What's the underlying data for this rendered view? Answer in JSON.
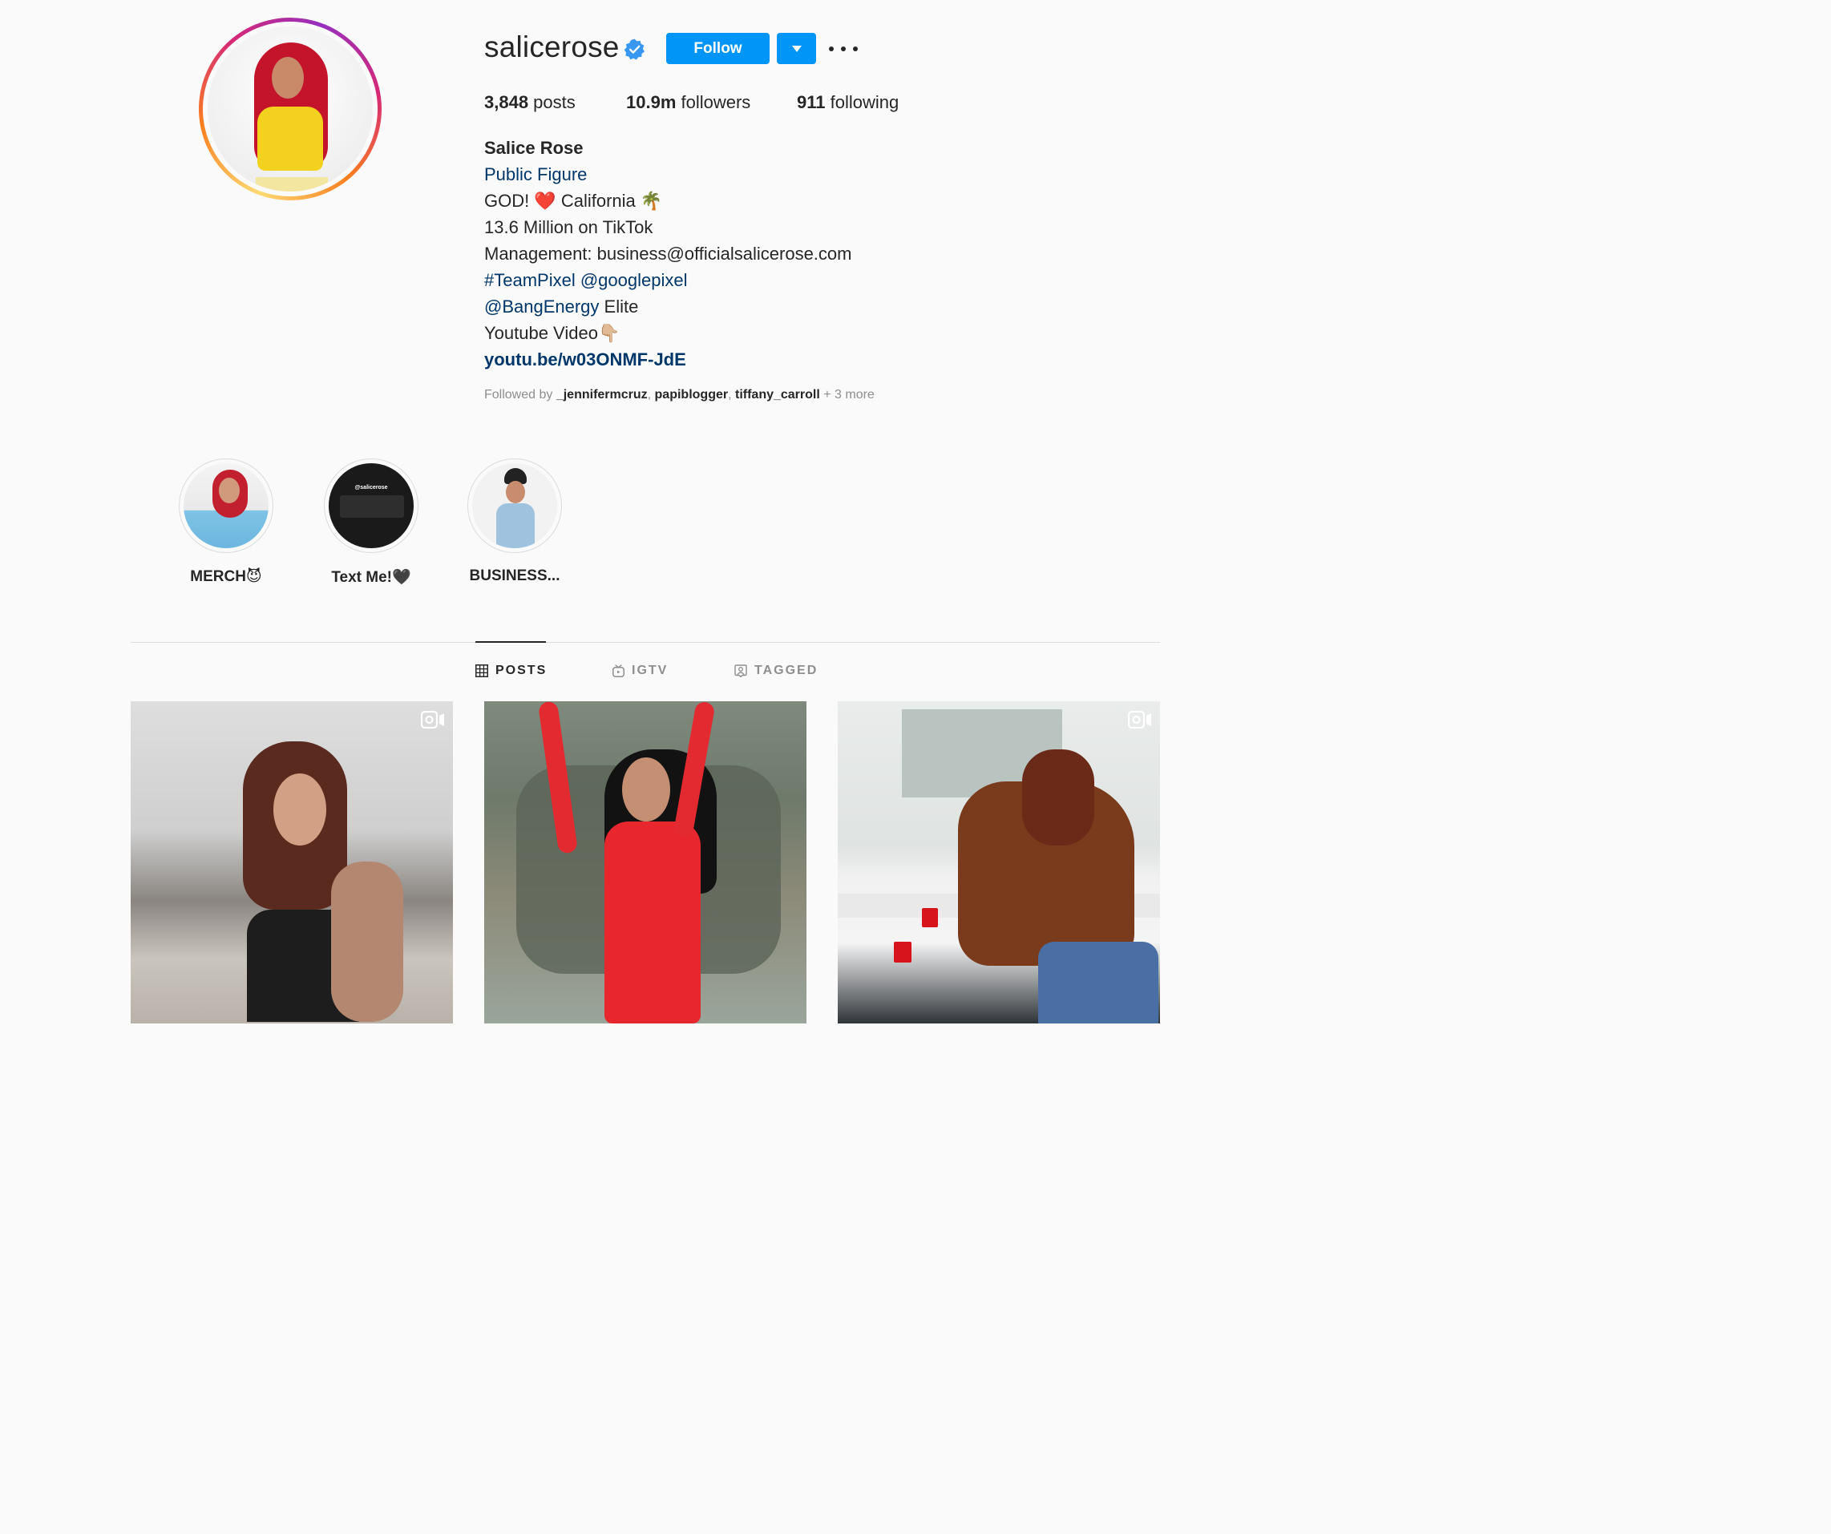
{
  "profile": {
    "username": "salicerose",
    "follow_label": "Follow",
    "stats": {
      "posts_count": "3,848",
      "posts_label": " posts",
      "followers_count": "10.9m",
      "followers_label": " followers",
      "following_count": "911",
      "following_label": " following"
    },
    "bio": {
      "full_name": "Salice Rose",
      "category": "Public Figure",
      "line1_a": "GOD! ",
      "line1_heart": "❤️",
      "line1_b": "  California ",
      "line1_palm": "🌴",
      "line2": "13.6 Million on TikTok",
      "line3": "Management: business@officialsalicerose.com",
      "hashtag": "#TeamPixel",
      "mention_google": "@googlepixel",
      "mention_bang": "@BangEnergy",
      "bang_suffix": " Elite",
      "youtube_text": "Youtube Video",
      "youtube_emoji": "👇🏼",
      "link": "youtu.be/w03ONMF-JdE"
    },
    "followed_by": {
      "prefix": "Followed by ",
      "users": [
        "_jennifermcruz",
        "papiblogger",
        "tiffany_carroll"
      ],
      "sep": ", ",
      "more": " + 3 more"
    }
  },
  "highlights": [
    {
      "label": "MERCH😈"
    },
    {
      "label": "Text Me!🖤"
    },
    {
      "label": "BUSINESS..."
    }
  ],
  "highlight_text_me_header": "@salicerose",
  "tabs": [
    {
      "label": "POSTS",
      "icon": "grid-icon",
      "active": true
    },
    {
      "label": "IGTV",
      "icon": "igtv-icon",
      "active": false
    },
    {
      "label": "TAGGED",
      "icon": "tagged-icon",
      "active": false
    }
  ],
  "posts": [
    {
      "type": "reel",
      "icon": "reel-icon"
    },
    {
      "type": "photo"
    },
    {
      "type": "reel",
      "icon": "reel-icon"
    }
  ],
  "colors": {
    "accent": "#0095f6",
    "link": "#00376b",
    "muted": "#8e8e8e",
    "background": "#fafafa",
    "verified": "#3897f0"
  }
}
